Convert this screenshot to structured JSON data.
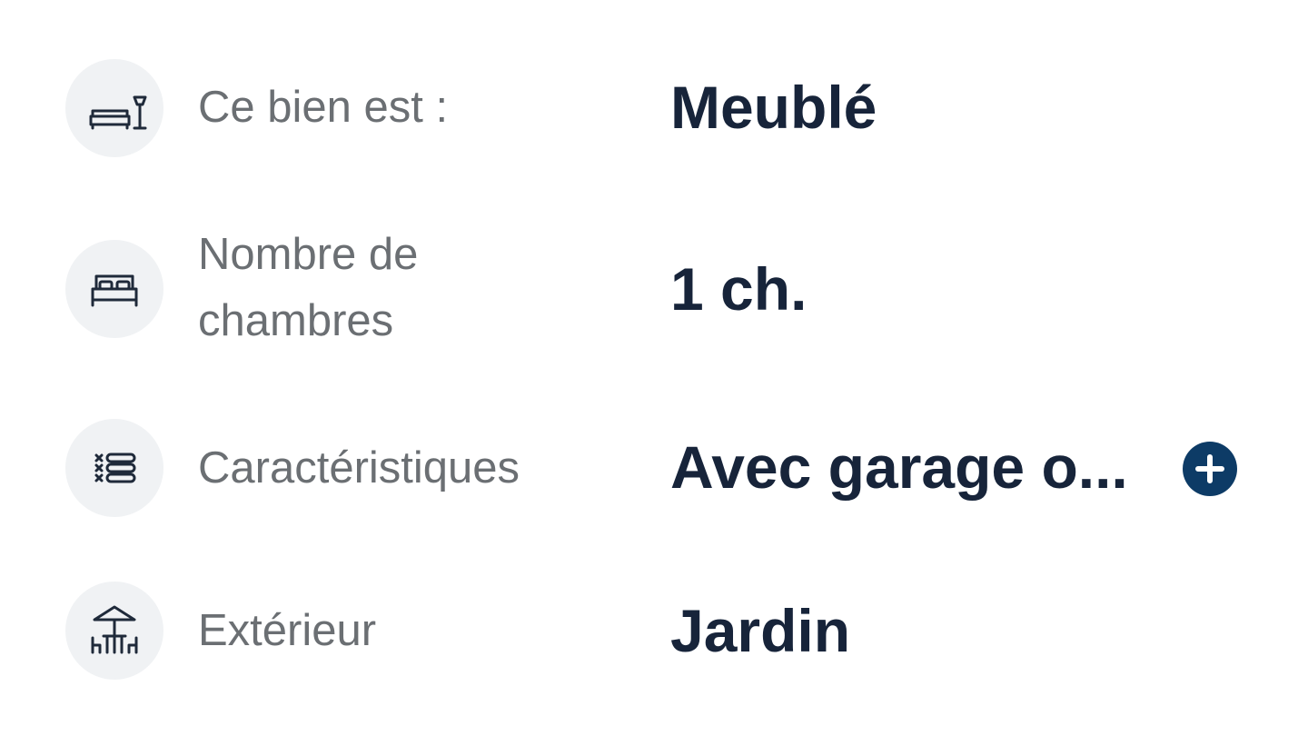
{
  "rows": [
    {
      "label": "Ce bien est :",
      "value": "Meublé",
      "icon": "furniture-icon"
    },
    {
      "label": "Nombre de chambres",
      "value": "1 ch.",
      "icon": "bed-icon"
    },
    {
      "label": "Caractéristiques",
      "value": "Avec garage o...",
      "icon": "features-list-icon",
      "expand_icon": "plus-icon"
    },
    {
      "label": "Extérieur",
      "value": "Jardin",
      "icon": "patio-table-icon"
    }
  ],
  "colors": {
    "icon_bg": "#f0f2f4",
    "label": "#6b6f73",
    "value": "#17243a",
    "accent": "#0d3b66"
  }
}
